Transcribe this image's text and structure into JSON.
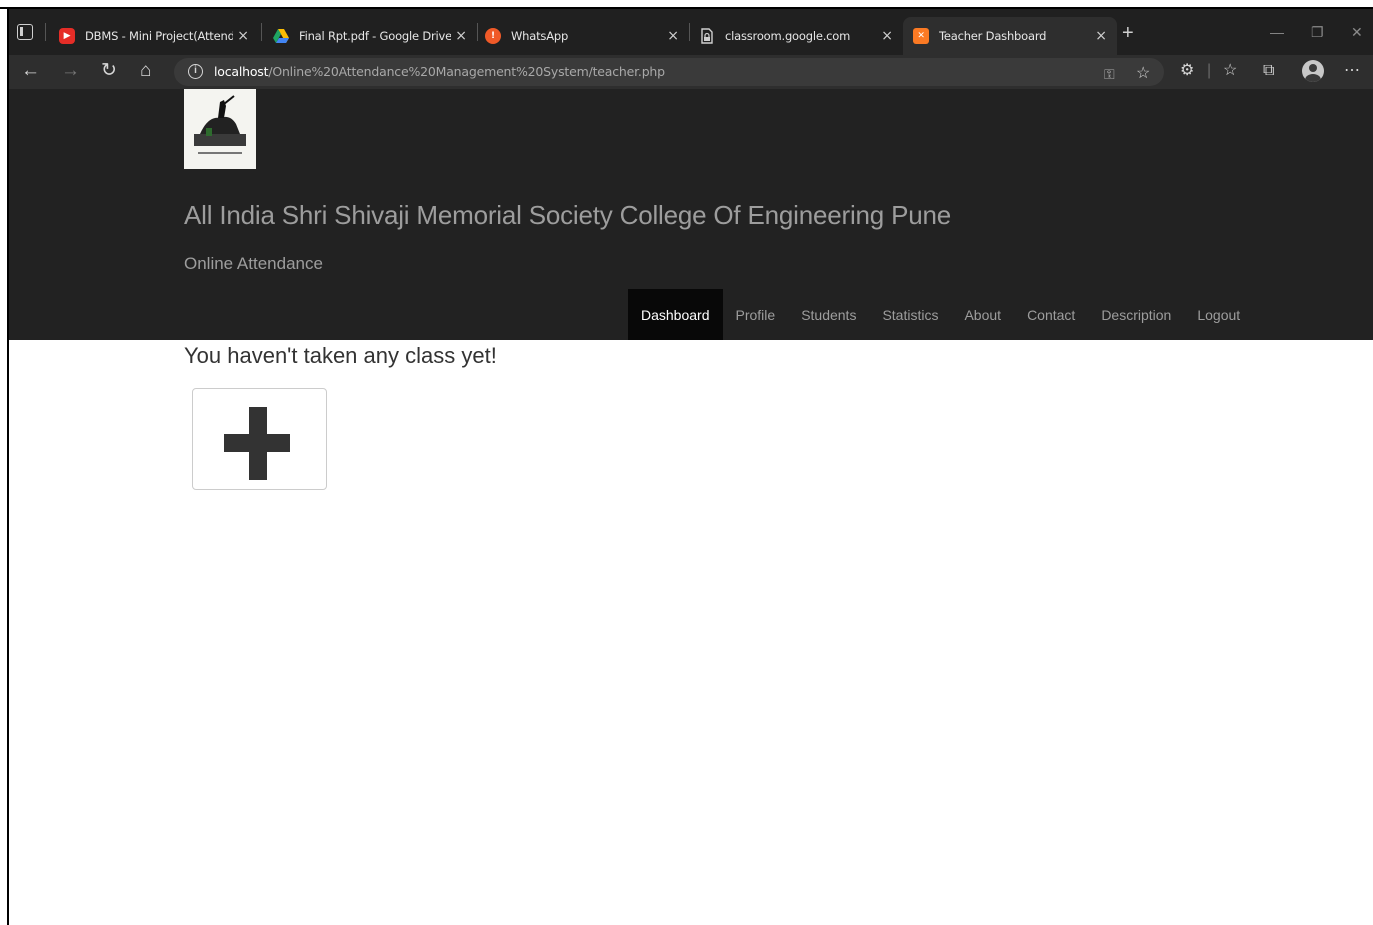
{
  "browser": {
    "tabs": [
      {
        "title": "DBMS - Mini Project(Attendance",
        "favicon": "youtube-icon",
        "color": "#e52d27"
      },
      {
        "title": "Final Rpt.pdf - Google Drive",
        "favicon": "google-drive-icon",
        "color": "#fbbc04"
      },
      {
        "title": "WhatsApp",
        "favicon": "whatsapp-icon",
        "color": "#f05a28"
      },
      {
        "title": "classroom.google.com",
        "favicon": "page-lock-icon",
        "color": "#cfcfcf"
      },
      {
        "title": "Teacher Dashboard",
        "favicon": "xampp-icon",
        "color": "#fb7a24",
        "active": true
      }
    ],
    "close_glyph": "×",
    "address": {
      "host": "localhost",
      "path": "/Online%20Attendance%20Management%20System/teacher.php"
    }
  },
  "site": {
    "college_name": "All India Shri Shivaji Memorial Society College Of Engineering Pune",
    "subtitle": "Online Attendance",
    "nav": [
      "Dashboard",
      "Profile",
      "Students",
      "Statistics",
      "About",
      "Contact",
      "Description",
      "Logout"
    ],
    "active_nav": "Dashboard"
  },
  "main": {
    "empty_message": "You haven't taken any class yet!",
    "add_class_icon": "plus-icon"
  },
  "colors": {
    "header_bg": "#222222",
    "nav_active_bg": "#080808",
    "nav_text": "#9d9d9d"
  }
}
